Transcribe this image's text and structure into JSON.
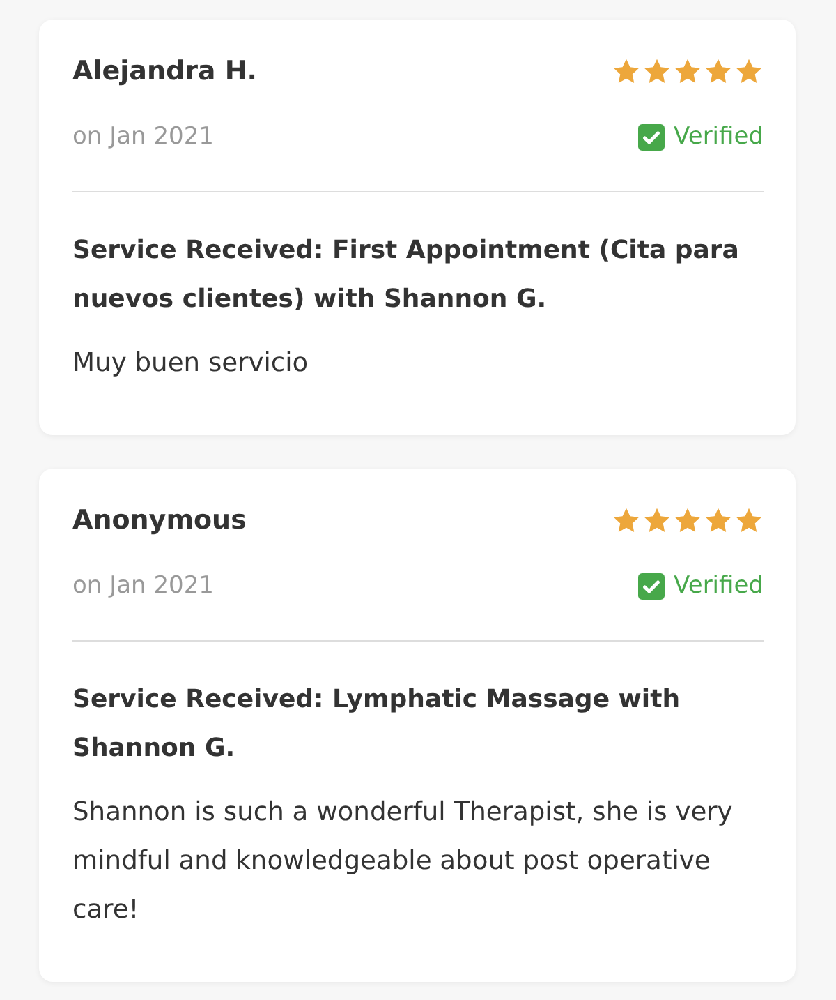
{
  "reviews": [
    {
      "author": "Alejandra H.",
      "stars": 5,
      "date": "on Jan 2021",
      "verified": true,
      "verified_label": "Verified",
      "service": "Service Received: First Appointment (Cita para nuevos clientes) with Shannon G.",
      "text": "Muy buen servicio"
    },
    {
      "author": "Anonymous",
      "stars": 5,
      "date": "on Jan 2021",
      "verified": true,
      "verified_label": "Verified",
      "service": "Service Received: Lymphatic Massage with Shannon G.",
      "text": "Shannon is such a wonderful Therapist, she is very mindful and knowledgeable about post operative care!"
    }
  ]
}
